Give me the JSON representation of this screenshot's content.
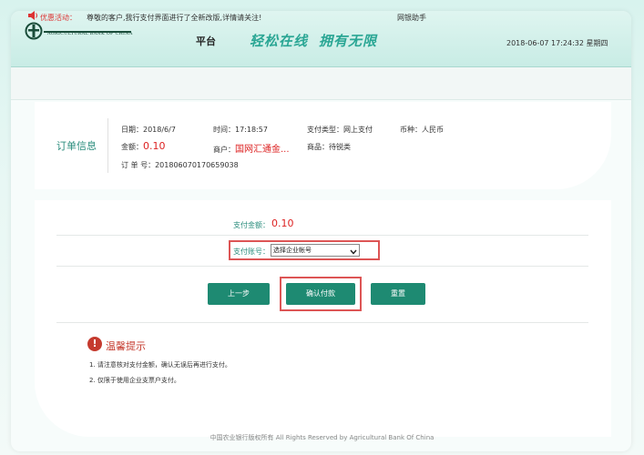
{
  "header": {
    "bank_name_en": "AGRICULTURAL BANK OF CHINA",
    "platform": "平台",
    "slogan_1": "轻松在线",
    "slogan_2": "拥有无限",
    "datetime": "2018-06-07 17:24:32 星期四"
  },
  "notice": {
    "label": "优惠活动：",
    "text": "尊敬的客户,我行支付界面进行了全新改版,详情请关注!",
    "helper": "网银助手"
  },
  "order": {
    "title": "订单信息",
    "date_label": "日期：",
    "date_value": "2018/6/7",
    "time_label": "时间：",
    "time_value": "17:18:57",
    "pay_type_label": "支付类型：",
    "pay_type_value": "网上支付",
    "currency_label": "币种：",
    "currency_value": "人民币",
    "amount_label": "金额：",
    "amount_value": "0.10",
    "merchant_label": "商户：",
    "merchant_value": "国网汇通金...",
    "goods_label": "商品：",
    "goods_value": "待锐类",
    "order_no_label": "订 单 号：",
    "order_no_value": "201806070170659038"
  },
  "payment": {
    "amount_label": "支付金额：",
    "amount_value": "0.10",
    "account_label": "支付账号：",
    "account_select_value": "选择企业帐号"
  },
  "buttons": {
    "prev": "上一步",
    "confirm": "确认付款",
    "reset": "重置"
  },
  "tips": {
    "title": "温馨提示",
    "line1": "1. 请注意核对支付金额，确认无误后再进行支付。",
    "line2": "2. 仅限于使用企业支票户支付。"
  },
  "footer": "中国农业银行版权所有 All Rights Reserved by Agricultural Bank Of China",
  "colors": {
    "accent_green": "#1e8a72",
    "slogan_teal": "#2aa694",
    "alert_red": "#d22",
    "highlight_red": "#d55"
  }
}
